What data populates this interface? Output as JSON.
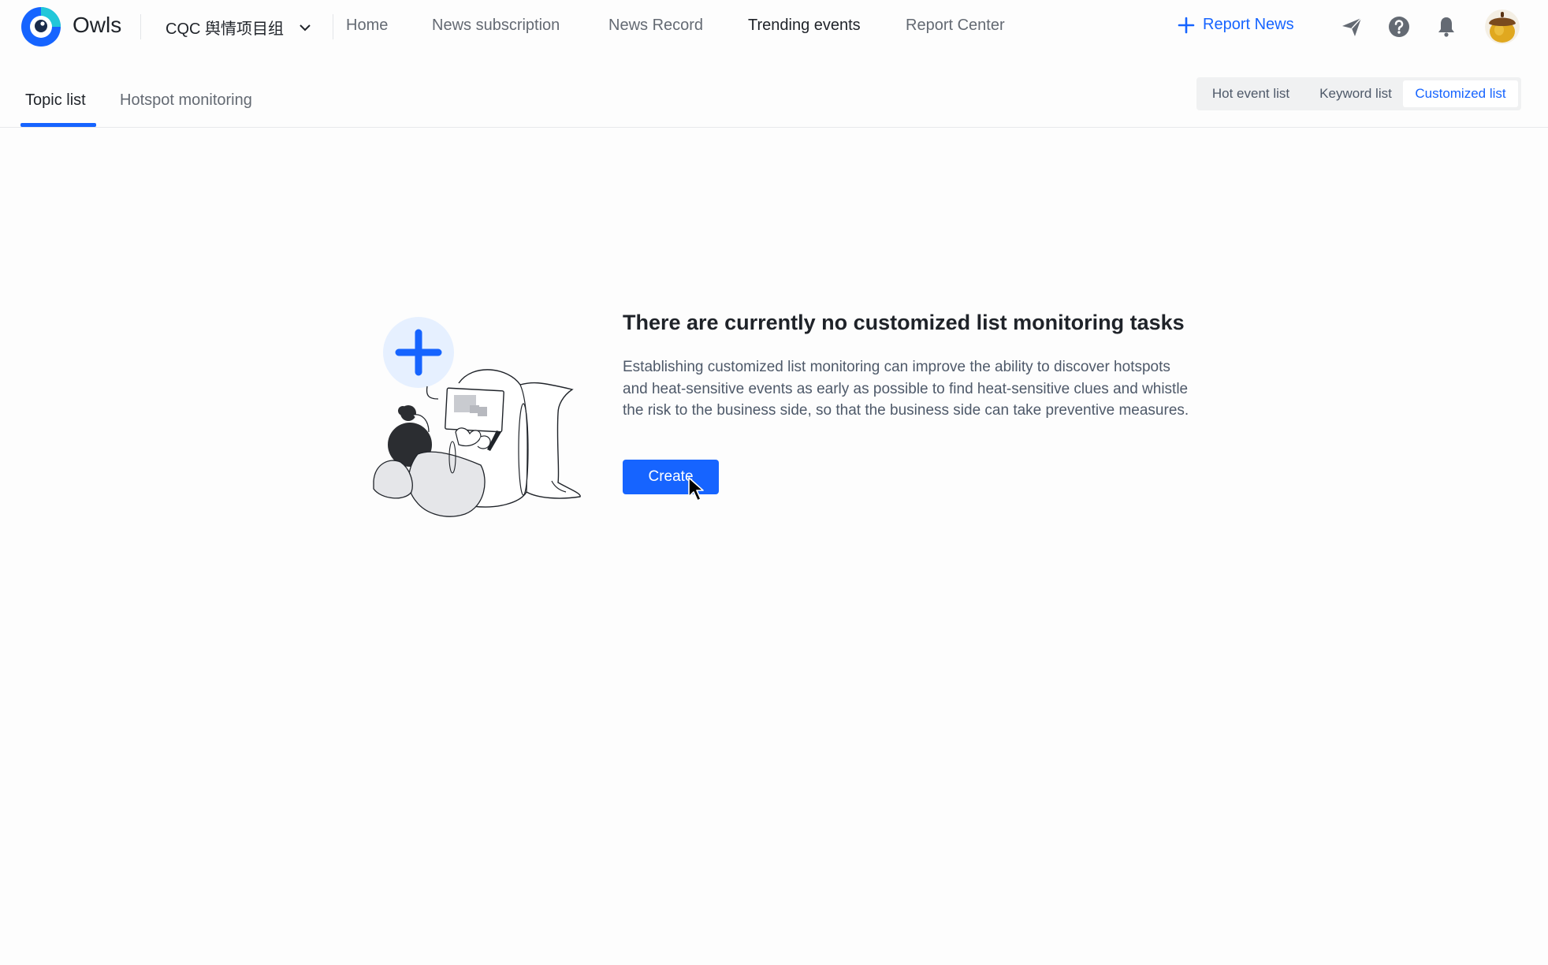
{
  "app": {
    "brand": "Owls",
    "project": "CQC 舆情项目组",
    "accent_color": "#1664ff"
  },
  "nav": {
    "items": [
      {
        "label": "Home"
      },
      {
        "label": "News subscription"
      },
      {
        "label": "News Record"
      },
      {
        "label": "Trending events",
        "active": true
      },
      {
        "label": "Report Center"
      }
    ],
    "report_news": "Report News",
    "icons": [
      "paper-plane-icon",
      "help-icon",
      "bell-icon"
    ]
  },
  "tabs": {
    "items": [
      {
        "label": "Topic list",
        "active": true
      },
      {
        "label": "Hotspot monitoring"
      }
    ]
  },
  "list_switch": {
    "options": [
      {
        "label": "Hot event list"
      },
      {
        "label": "Keyword list"
      },
      {
        "label": "Customized list",
        "active": true
      }
    ]
  },
  "empty_state": {
    "title": "There are currently no customized list monitoring tasks",
    "description": "Establishing customized list monitoring can improve the ability to discover hotspots and heat-sensitive events as early as possible to find heat-sensitive clues and whistle the risk to the business side, so that the business side can take preventive measures.",
    "create_label": "Create"
  }
}
